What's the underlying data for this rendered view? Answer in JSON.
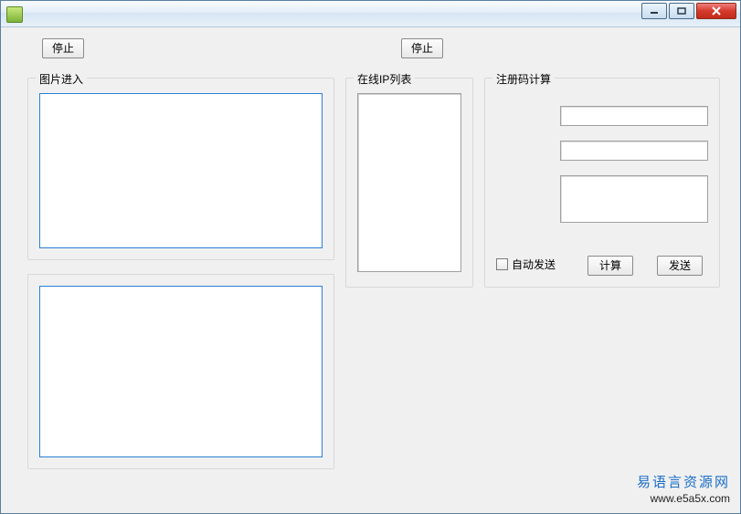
{
  "titlebar": {
    "title": ""
  },
  "buttons": {
    "stop_left": "停止",
    "stop_right": "停止",
    "calculate": "计算",
    "send": "发送"
  },
  "groups": {
    "image_in": "图片进入",
    "ip_list": "在线IP列表",
    "reg_calc": "注册码计算"
  },
  "checkbox": {
    "auto_send": "自动发送",
    "auto_send_checked": false
  },
  "fields": {
    "reg_input1": "",
    "reg_input2": "",
    "reg_output": ""
  },
  "watermark": {
    "line1": "易语言资源网",
    "line2": "www.e5a5x.com"
  }
}
